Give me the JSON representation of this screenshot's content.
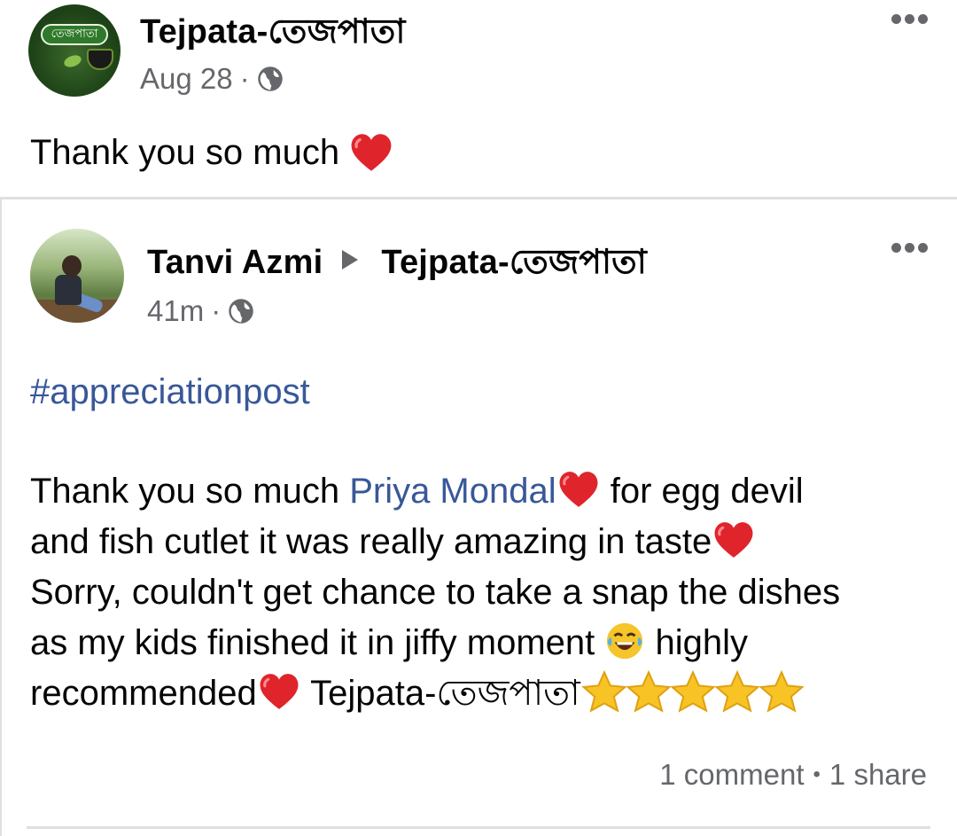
{
  "outer_post": {
    "author": "Tejpata-তেজপাতা",
    "avatar_label": "তেজপাতা",
    "date": "Aug 28",
    "separator": "·",
    "privacy_icon": "globe-icon",
    "text": "Thank you so much",
    "emoji": "red-heart"
  },
  "shared_post": {
    "author": "Tanvi Azmi",
    "target_page": "Tejpata-তেজপাতা",
    "time": "41m",
    "separator": "·",
    "privacy_icon": "globe-icon",
    "hashtag": "#appreciationpost",
    "body": {
      "line1_pre": "Thank you so much ",
      "line1_mention": "Priya Mondal",
      "line1_post": " for egg devil",
      "line2": "and fish cutlet it was really amazing in taste",
      "line3": "Sorry, couldn't get chance to take a snap the dishes",
      "line4_pre": "as my kids finished it in jiffy moment ",
      "line4_post": " highly",
      "line5_pre": "recommended",
      "line5_post": " Tejpata-তেজপাতা"
    },
    "star_count": 5,
    "stats": {
      "comments": "1 comment",
      "bullet": "•",
      "shares": "1 share"
    }
  },
  "colors": {
    "link_blue": "#385898",
    "meta_grey": "#65676b",
    "divider": "#dddfe2",
    "heart_red": "#e0242b",
    "star_yellow": "#f7c325"
  }
}
